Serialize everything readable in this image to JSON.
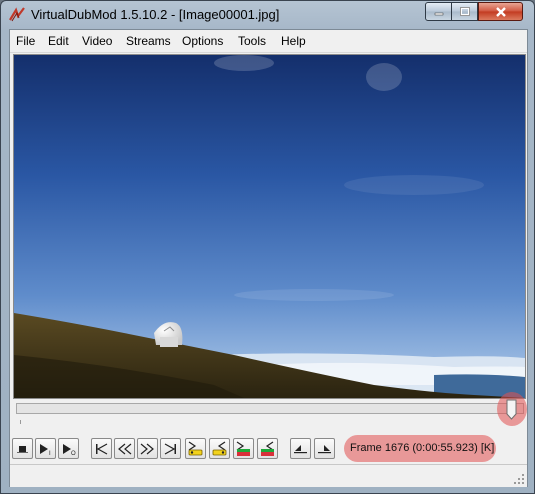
{
  "window": {
    "title": "VirtualDubMod 1.5.10.2 - [Image00001.jpg]",
    "icon": "virtualdub-logo-icon",
    "controls": [
      "minimize-icon",
      "maximize-icon",
      "close-icon"
    ]
  },
  "menu": {
    "items": [
      "File",
      "Edit",
      "Video",
      "Streams",
      "Options",
      "Tools",
      "Help"
    ]
  },
  "video": {
    "description_icon": "video-frame-preview"
  },
  "timeline": {
    "position_fraction": 0.985
  },
  "toolbar": {
    "buttons": [
      "stop-icon",
      "play-input-icon",
      "play-output-icon",
      "go-start-icon",
      "prev-frame-icon",
      "next-frame-icon",
      "go-end-icon",
      "prev-keyframe-icon",
      "next-keyframe-icon",
      "scene-back-icon",
      "scene-forward-icon",
      "mark-in-icon",
      "mark-out-icon"
    ]
  },
  "status": {
    "frame_text": "Frame 1676 (0:00:55.923) [K]"
  },
  "colors": {
    "highlight": "#e25050",
    "sky_top": "#1b3a80",
    "sky_bottom": "#8fb3dc"
  }
}
